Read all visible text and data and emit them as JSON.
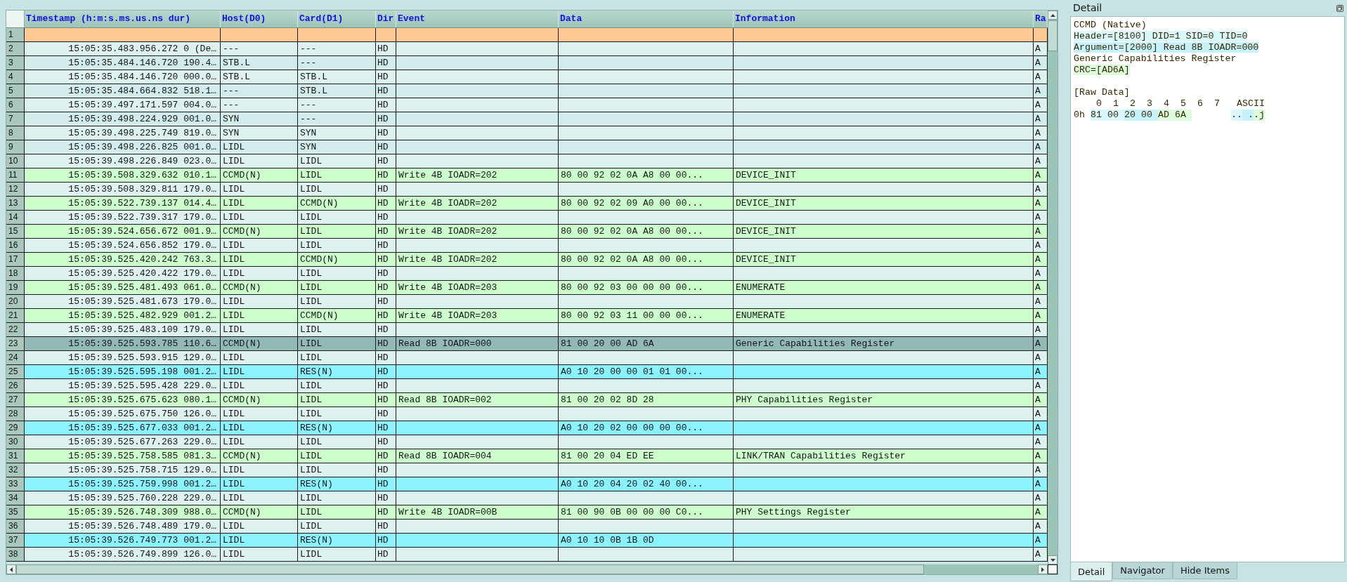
{
  "table": {
    "columns": [
      "Timestamp (h:m:s.ms.us.ns dur)",
      "Host(D0)",
      "Card(D1)",
      "Dir",
      "Event",
      "Data",
      "Information",
      "Ra"
    ],
    "rows": [
      {
        "number": "1",
        "kind": "marker",
        "selected": false
      },
      {
        "number": "2",
        "kind": "idle",
        "selected": false,
        "timestamp": "15:05:35.483.956.272 0 (De…",
        "host": "---",
        "card": "---",
        "dir": "HD",
        "column_9": "A"
      },
      {
        "number": "3",
        "kind": "idle",
        "selected": false,
        "timestamp": "15:05:35.484.146.720 190.4…",
        "host": "STB.L",
        "card": "---",
        "dir": "HD",
        "column_9": "A"
      },
      {
        "number": "4",
        "kind": "idle",
        "selected": false,
        "timestamp": "15:05:35.484.146.720 000.0…",
        "host": "STB.L",
        "card": "STB.L",
        "dir": "HD",
        "column_9": "A"
      },
      {
        "number": "5",
        "kind": "idle",
        "selected": false,
        "timestamp": "15:05:35.484.664.832 518.1…",
        "host": "---",
        "card": "STB.L",
        "dir": "HD",
        "column_9": "A"
      },
      {
        "number": "6",
        "kind": "idle",
        "selected": false,
        "timestamp": "15:05:39.497.171.597 004.0…",
        "host": "---",
        "card": "---",
        "dir": "HD",
        "column_9": "A"
      },
      {
        "number": "7",
        "kind": "idle",
        "selected": false,
        "timestamp": "15:05:39.498.224.929 001.0…",
        "host": "SYN",
        "card": "---",
        "dir": "HD",
        "column_9": "A"
      },
      {
        "number": "8",
        "kind": "idle",
        "selected": false,
        "timestamp": "15:05:39.498.225.749 819.0…",
        "host": "SYN",
        "card": "SYN",
        "dir": "HD",
        "column_9": "A"
      },
      {
        "number": "9",
        "kind": "idle",
        "selected": false,
        "timestamp": "15:05:39.498.226.825 001.0…",
        "host": "LIDL",
        "card": "SYN",
        "dir": "HD",
        "column_9": "A"
      },
      {
        "number": "10",
        "kind": "idle",
        "selected": false,
        "timestamp": "15:05:39.498.226.849 023.0…",
        "host": "LIDL",
        "card": "LIDL",
        "dir": "HD",
        "column_9": "A"
      },
      {
        "number": "11",
        "kind": "ccmd",
        "selected": false,
        "timestamp": "15:05:39.508.329.632 010.1…",
        "host": "CCMD(N)",
        "card": "LIDL",
        "dir": "HD",
        "event": "Write 4B IOADR=202",
        "data": "80 00 92 02 0A A8 00 00...",
        "information": "DEVICE_INIT",
        "column_9": "A"
      },
      {
        "number": "12",
        "kind": "idle",
        "selected": false,
        "timestamp": "15:05:39.508.329.811 179.0…",
        "host": "LIDL",
        "card": "LIDL",
        "dir": "HD",
        "column_9": "A"
      },
      {
        "number": "13",
        "kind": "ccmd",
        "selected": false,
        "timestamp": "15:05:39.522.739.137 014.4…",
        "host": "LIDL",
        "card": "CCMD(N)",
        "dir": "HD",
        "event": "Write 4B IOADR=202",
        "data": "80 00 92 02 09 A0 00 00...",
        "information": "DEVICE_INIT",
        "column_9": "A"
      },
      {
        "number": "14",
        "kind": "idle",
        "selected": false,
        "timestamp": "15:05:39.522.739.317 179.0…",
        "host": "LIDL",
        "card": "LIDL",
        "dir": "HD",
        "column_9": "A"
      },
      {
        "number": "15",
        "kind": "ccmd",
        "selected": false,
        "timestamp": "15:05:39.524.656.672 001.9…",
        "host": "CCMD(N)",
        "card": "LIDL",
        "dir": "HD",
        "event": "Write 4B IOADR=202",
        "data": "80 00 92 02 0A A8 00 00...",
        "information": "DEVICE_INIT",
        "column_9": "A"
      },
      {
        "number": "16",
        "kind": "idle",
        "selected": false,
        "timestamp": "15:05:39.524.656.852 179.0…",
        "host": "LIDL",
        "card": "LIDL",
        "dir": "HD",
        "column_9": "A"
      },
      {
        "number": "17",
        "kind": "ccmd",
        "selected": false,
        "timestamp": "15:05:39.525.420.242 763.3…",
        "host": "LIDL",
        "card": "CCMD(N)",
        "dir": "HD",
        "event": "Write 4B IOADR=202",
        "data": "80 00 92 02 0A A8 00 00...",
        "information": "DEVICE_INIT",
        "column_9": "A"
      },
      {
        "number": "18",
        "kind": "idle",
        "selected": false,
        "timestamp": "15:05:39.525.420.422 179.0…",
        "host": "LIDL",
        "card": "LIDL",
        "dir": "HD",
        "column_9": "A"
      },
      {
        "number": "19",
        "kind": "ccmd",
        "selected": false,
        "timestamp": "15:05:39.525.481.493 061.0…",
        "host": "CCMD(N)",
        "card": "LIDL",
        "dir": "HD",
        "event": "Write 4B IOADR=203",
        "data": "80 00 92 03 00 00 00 00...",
        "information": "ENUMERATE",
        "column_9": "A"
      },
      {
        "number": "20",
        "kind": "idle",
        "selected": false,
        "timestamp": "15:05:39.525.481.673 179.0…",
        "host": "LIDL",
        "card": "LIDL",
        "dir": "HD",
        "column_9": "A"
      },
      {
        "number": "21",
        "kind": "ccmd",
        "selected": false,
        "timestamp": "15:05:39.525.482.929 001.2…",
        "host": "LIDL",
        "card": "CCMD(N)",
        "dir": "HD",
        "event": "Write 4B IOADR=203",
        "data": "80 00 92 03 11 00 00 00...",
        "information": "ENUMERATE",
        "column_9": "A"
      },
      {
        "number": "22",
        "kind": "idle",
        "selected": false,
        "timestamp": "15:05:39.525.483.109 179.0…",
        "host": "LIDL",
        "card": "LIDL",
        "dir": "HD",
        "column_9": "A"
      },
      {
        "number": "23",
        "kind": "ccmd",
        "selected": true,
        "timestamp": "15:05:39.525.593.785 110.6…",
        "host": "CCMD(N)",
        "card": "LIDL",
        "dir": "HD",
        "event": "Read 8B IOADR=000",
        "data": "81 00 20 00 AD 6A",
        "information": "Generic Capabilities Register",
        "column_9": "A"
      },
      {
        "number": "24",
        "kind": "idle",
        "selected": false,
        "timestamp": "15:05:39.525.593.915 129.0…",
        "host": "LIDL",
        "card": "LIDL",
        "dir": "HD",
        "column_9": "A"
      },
      {
        "number": "25",
        "kind": "res",
        "selected": false,
        "timestamp": "15:05:39.525.595.198 001.2…",
        "host": "LIDL",
        "card": "RES(N)",
        "dir": "HD",
        "data": "A0 10 20 00 00 01 01 00...",
        "column_9": "A"
      },
      {
        "number": "26",
        "kind": "idle",
        "selected": false,
        "timestamp": "15:05:39.525.595.428 229.0…",
        "host": "LIDL",
        "card": "LIDL",
        "dir": "HD",
        "column_9": "A"
      },
      {
        "number": "27",
        "kind": "ccmd",
        "selected": false,
        "timestamp": "15:05:39.525.675.623 080.1…",
        "host": "CCMD(N)",
        "card": "LIDL",
        "dir": "HD",
        "event": "Read 8B IOADR=002",
        "data": "81 00 20 02 8D 28",
        "information": "PHY Capabilities Register",
        "column_9": "A"
      },
      {
        "number": "28",
        "kind": "idle",
        "selected": false,
        "timestamp": "15:05:39.525.675.750 126.0…",
        "host": "LIDL",
        "card": "LIDL",
        "dir": "HD",
        "column_9": "A"
      },
      {
        "number": "29",
        "kind": "res",
        "selected": false,
        "timestamp": "15:05:39.525.677.033 001.2…",
        "host": "LIDL",
        "card": "RES(N)",
        "dir": "HD",
        "data": "A0 10 20 02 00 00 00 00...",
        "column_9": "A"
      },
      {
        "number": "30",
        "kind": "idle",
        "selected": false,
        "timestamp": "15:05:39.525.677.263 229.0…",
        "host": "LIDL",
        "card": "LIDL",
        "dir": "HD",
        "column_9": "A"
      },
      {
        "number": "31",
        "kind": "ccmd",
        "selected": false,
        "timestamp": "15:05:39.525.758.585 081.3…",
        "host": "CCMD(N)",
        "card": "LIDL",
        "dir": "HD",
        "event": "Read 8B IOADR=004",
        "data": "81 00 20 04 ED EE",
        "information": "LINK/TRAN Capabilities Register",
        "column_9": "A"
      },
      {
        "number": "32",
        "kind": "idle",
        "selected": false,
        "timestamp": "15:05:39.525.758.715 129.0…",
        "host": "LIDL",
        "card": "LIDL",
        "dir": "HD",
        "column_9": "A"
      },
      {
        "number": "33",
        "kind": "res",
        "selected": false,
        "timestamp": "15:05:39.525.759.998 001.2…",
        "host": "LIDL",
        "card": "RES(N)",
        "dir": "HD",
        "data": "A0 10 20 04 20 02 40 00...",
        "column_9": "A"
      },
      {
        "number": "34",
        "kind": "idle",
        "selected": false,
        "timestamp": "15:05:39.525.760.228 229.0…",
        "host": "LIDL",
        "card": "LIDL",
        "dir": "HD",
        "column_9": "A"
      },
      {
        "number": "35",
        "kind": "ccmd",
        "selected": false,
        "timestamp": "15:05:39.526.748.309 988.0…",
        "host": "CCMD(N)",
        "card": "LIDL",
        "dir": "HD",
        "event": "Write 4B IOADR=00B",
        "data": "81 00 90 0B 00 00 00 C0...",
        "information": "PHY Settings Register",
        "column_9": "A"
      },
      {
        "number": "36",
        "kind": "idle",
        "selected": false,
        "timestamp": "15:05:39.526.748.489 179.0…",
        "host": "LIDL",
        "card": "LIDL",
        "dir": "HD",
        "column_9": "A"
      },
      {
        "number": "37",
        "kind": "res",
        "selected": false,
        "timestamp": "15:05:39.526.749.773 001.2…",
        "host": "LIDL",
        "card": "RES(N)",
        "dir": "HD",
        "data": "A0 10 10 0B 1B 0D",
        "column_9": "A"
      },
      {
        "number": "38",
        "kind": "idle",
        "selected": false,
        "timestamp": "15:05:39.526.749.899 126.0…",
        "host": "LIDL",
        "card": "LIDL",
        "dir": "HD",
        "column_9": "A"
      }
    ]
  },
  "detail_panel": {
    "title": "Detail",
    "lines": [
      {
        "text": "CCMD (Native)",
        "kind": "plain"
      },
      {
        "text": "Header=[8100] DID=1 SID=0 TID=0",
        "kind": "header"
      },
      {
        "text": "Argument=[2000] Read 8B IOADR=000",
        "kind": "argument"
      },
      {
        "text": "Generic Capabilities Register",
        "kind": "plain"
      },
      {
        "text": "CRC=[AD6A]",
        "kind": "crc"
      }
    ],
    "raw_data": {
      "title": "[Raw Data]",
      "columns": [
        "0",
        "1",
        "2",
        "3",
        "4",
        "5",
        "6",
        "7"
      ],
      "ascii_label": "ASCII",
      "rows": [
        {
          "offset": "0h",
          "bytes": [
            {
              "text": "81",
              "kind": "header"
            },
            {
              "text": "00",
              "kind": "header"
            },
            {
              "text": "20",
              "kind": "argument"
            },
            {
              "text": "00",
              "kind": "argument"
            },
            {
              "text": "AD",
              "kind": "crc"
            },
            {
              "text": "6A",
              "kind": "crc"
            }
          ],
          "ascii": [
            {
              "text": "..",
              "kind": "header"
            },
            {
              "text": " .",
              "kind": "argument"
            },
            {
              "text": ".j",
              "kind": "crc"
            }
          ]
        }
      ]
    }
  },
  "tabs": [
    {
      "label": "Detail",
      "selected": true
    },
    {
      "label": "Navigator",
      "selected": false
    },
    {
      "label": "Hide Items",
      "selected": false
    }
  ]
}
